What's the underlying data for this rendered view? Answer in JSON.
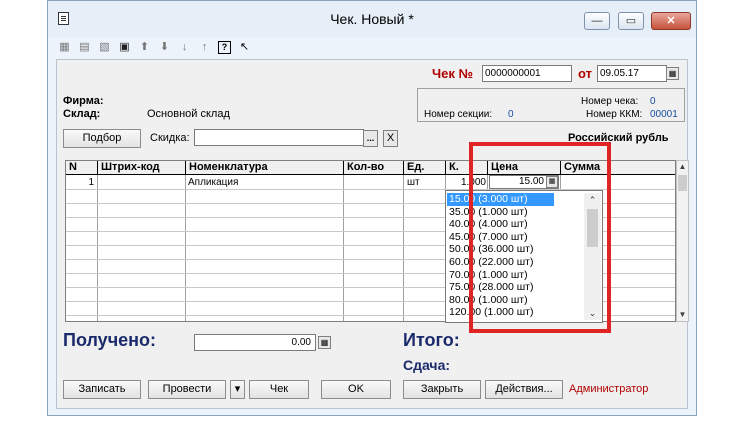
{
  "window": {
    "title": "Чек. Новый *",
    "controls": {
      "minimize": "—",
      "maximize": "▭",
      "close": "✕"
    }
  },
  "toolbar": {
    "icons": [
      "table-icon",
      "table-add-icon",
      "table-delete-icon",
      "copy-icon",
      "arrow-up-icon",
      "arrow-down-icon",
      "sort-asc-icon",
      "sort-desc-icon",
      "help-icon",
      "whats-this-icon"
    ],
    "glyphs": [
      "▦",
      "▤",
      "▧",
      "▣",
      "⬆",
      "⬇",
      "↓",
      "↑",
      "?",
      "↖"
    ]
  },
  "header": {
    "check_label": "Чек №",
    "check_number": "0000000001",
    "date_label": "от",
    "date": "09.05.17"
  },
  "info": {
    "firm_label": "Фирма:",
    "warehouse_label": "Склад:",
    "warehouse_value": "Основной склад",
    "check_num_label": "Номер чека:",
    "check_num_value": "0",
    "section_label": "Номер секции:",
    "section_value": "0",
    "kkm_label": "Номер ККМ:",
    "kkm_value": "00001",
    "currency": "Российский рубль"
  },
  "selection": {
    "select_button": "Подбор",
    "discount_label": "Скидка:",
    "discount_value": "",
    "ellipsis": "...",
    "clear": "X"
  },
  "table": {
    "columns": [
      "N",
      "Штрих-код",
      "Номенклатура",
      "Кол-во",
      "Ед.",
      "К.",
      "Цена",
      "Сумма"
    ],
    "rows": [
      {
        "n": "1",
        "barcode": "",
        "item": "Апликация",
        "qty": "",
        "unit": "шт",
        "k": "1.000",
        "price": "15.00",
        "sum": ""
      }
    ]
  },
  "price_dropdown": {
    "options": [
      "15.00 (3.000 шт)",
      "35.00 (1.000 шт)",
      "40.00 (4.000 шт)",
      "45.00 (7.000 шт)",
      "50.00 (36.000 шт)",
      "60.00 (22.000 шт)",
      "70.00 (1.000 шт)",
      "75.00 (28.000 шт)",
      "80.00 (1.000 шт)",
      "120.00 (1.000 шт)"
    ],
    "selected_index": 0
  },
  "totals": {
    "received_label": "Получено:",
    "received_value": "0.00",
    "total_label": "Итого:",
    "change_label": "Сдача:"
  },
  "buttons": {
    "save": "Записать",
    "post": "Провести",
    "menu_arrow": "▾",
    "check": "Чек",
    "ok": "OK",
    "close": "Закрыть",
    "actions": "Действия...",
    "user": "Администратор"
  },
  "colors": {
    "highlight": "#e02424",
    "selection": "#3399ff",
    "totals_text": "#1b2a6b",
    "red_text": "#b00000"
  }
}
